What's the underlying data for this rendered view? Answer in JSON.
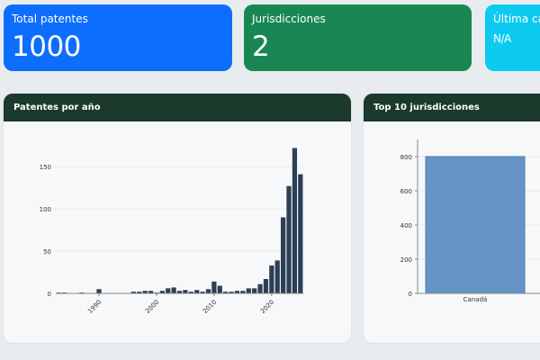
{
  "cards": {
    "total": {
      "label": "Total patentes",
      "value": "1000",
      "color": "#0d6efd"
    },
    "jurisdictions": {
      "label": "Jurisdicciones",
      "value": "2",
      "color": "#198754"
    },
    "last_update": {
      "label": "Última car",
      "value": "N/A",
      "color": "#0dcaf0"
    }
  },
  "panels": {
    "year": {
      "title": "Patentes por año"
    },
    "jurisdictions": {
      "title": "Top 10 jurisdicciones"
    }
  },
  "colors": {
    "header": "#1b3a2c",
    "year_bars": "#2b3f55",
    "juris_bars": "#6394c3"
  },
  "chart_data": [
    {
      "type": "bar",
      "xlabel": "",
      "ylabel": "",
      "ylim": [
        0,
        180
      ],
      "yticks": [
        0,
        50,
        100,
        150
      ],
      "xticks": [
        1990,
        2000,
        2010,
        2020
      ],
      "x": [
        1983,
        1984,
        1987,
        1990,
        1996,
        1997,
        1998,
        1999,
        2000,
        2001,
        2002,
        2003,
        2004,
        2005,
        2006,
        2007,
        2008,
        2009,
        2010,
        2011,
        2012,
        2013,
        2014,
        2015,
        2016,
        2017,
        2018,
        2019,
        2020,
        2021,
        2022,
        2023,
        2024,
        2025
      ],
      "values": [
        1,
        1,
        1,
        5,
        2,
        2,
        3,
        3,
        1,
        3,
        6,
        7,
        3,
        4,
        2,
        4,
        2,
        5,
        14,
        9,
        2,
        2,
        3,
        3,
        6,
        6,
        11,
        17,
        33,
        39,
        90,
        127,
        172,
        141
      ],
      "grid": true
    },
    {
      "type": "bar",
      "xlabel": "",
      "ylabel": "",
      "ylim": [
        0,
        900
      ],
      "yticks": [
        0,
        200,
        400,
        600,
        800
      ],
      "categories": [
        "Canadá"
      ],
      "values": [
        800
      ],
      "grid": true
    }
  ]
}
